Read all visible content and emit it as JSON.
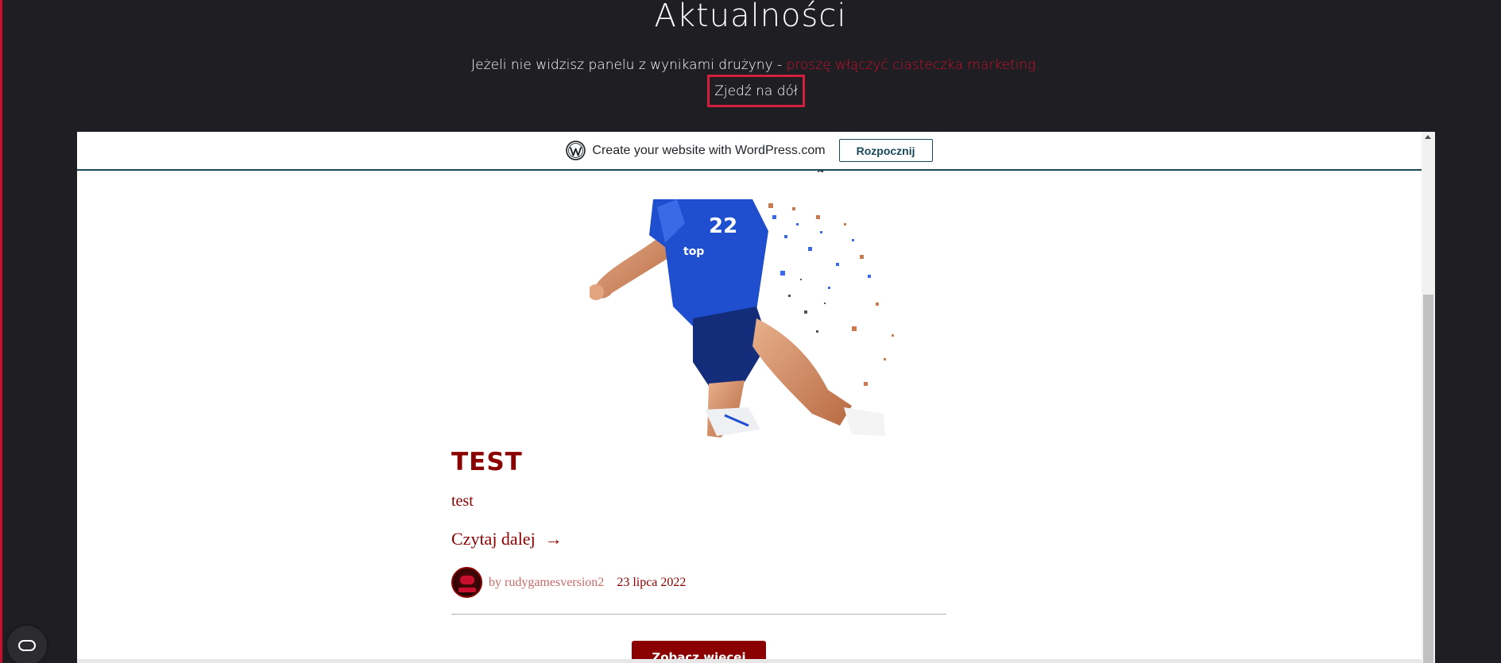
{
  "header": {
    "title": "Aktualności",
    "notice_text": "Jeżeli nie widzisz panelu z wynikami drużyny - ",
    "notice_link": "proszę włączyć ciasteczka marketing.",
    "scroll_button": "Zjedź na dół"
  },
  "wp_banner": {
    "text": "Create your website with WordPress.com",
    "button": "Rozpocznij",
    "icon": "wordpress-logo-icon"
  },
  "post": {
    "title": "TEST",
    "excerpt": "test",
    "read_more": "Czytaj dalej",
    "read_more_arrow": "→",
    "author": "by rudygamesversion2",
    "date": "23 lipca 2022"
  },
  "more_results_button": "Zobacz więcej wyników",
  "cookie_button": {
    "icon": "cookie-settings-icon"
  },
  "colors": {
    "background": "#1f1e23",
    "accent": "#c8102e",
    "post_red": "#8b0000",
    "wp_border": "#1a4a5a"
  }
}
